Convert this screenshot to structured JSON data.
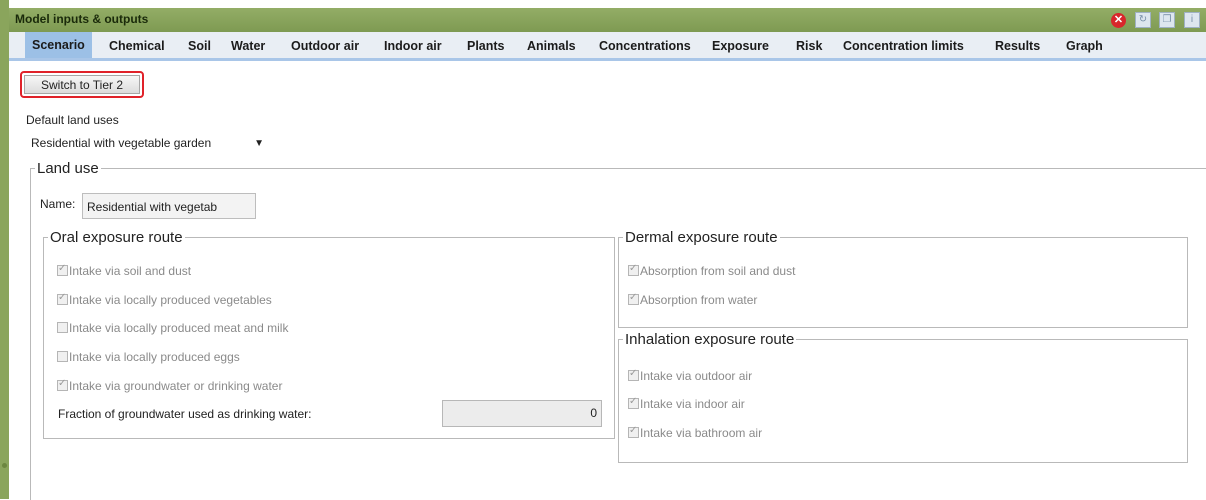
{
  "window": {
    "title": "Model inputs & outputs",
    "buttons": [
      {
        "name": "close",
        "icon": "close-icon",
        "glyph": "✕"
      },
      {
        "name": "refresh",
        "icon": "refresh-icon",
        "glyph": "↻"
      },
      {
        "name": "copy",
        "icon": "copy-icon",
        "glyph": "❐"
      },
      {
        "name": "info",
        "icon": "info-icon",
        "glyph": "i"
      }
    ]
  },
  "tabs": [
    "Scenario",
    "Chemical",
    "Soil",
    "Water",
    "Outdoor air",
    "Indoor air",
    "Plants",
    "Animals",
    "Concentrations",
    "Exposure",
    "Risk",
    "Concentration limits",
    "Results",
    "Graph"
  ],
  "active_tab": "Scenario",
  "switch_button": "Switch to Tier 2",
  "default_land_uses": {
    "label": "Default land uses",
    "selected": "Residential with vegetable garden"
  },
  "land_use": {
    "legend": "Land use",
    "name_label": "Name:",
    "name_value": "Residential with vegetab"
  },
  "oral": {
    "legend": "Oral exposure route",
    "items": [
      {
        "label": "Intake via soil and dust",
        "checked": true
      },
      {
        "label": "Intake via locally produced vegetables",
        "checked": true
      },
      {
        "label": "Intake via locally produced meat and milk",
        "checked": false
      },
      {
        "label": "Intake via locally produced eggs",
        "checked": false
      },
      {
        "label": "Intake via groundwater or drinking water",
        "checked": true
      }
    ],
    "fraction_label": "Fraction of groundwater used as drinking water:",
    "fraction_value": "0"
  },
  "dermal": {
    "legend": "Dermal exposure route",
    "items": [
      {
        "label": "Absorption from soil and dust",
        "checked": true
      },
      {
        "label": "Absorption from water",
        "checked": true
      }
    ]
  },
  "inhalation": {
    "legend": "Inhalation exposure route",
    "items": [
      {
        "label": "Intake via outdoor air",
        "checked": true
      },
      {
        "label": "Intake via indoor air",
        "checked": true
      },
      {
        "label": "Intake via bathroom air",
        "checked": true
      }
    ]
  },
  "colors": {
    "titlebar": "#8aa55c",
    "tab_active": "#9cc0e6",
    "highlight": "#e0222a"
  }
}
